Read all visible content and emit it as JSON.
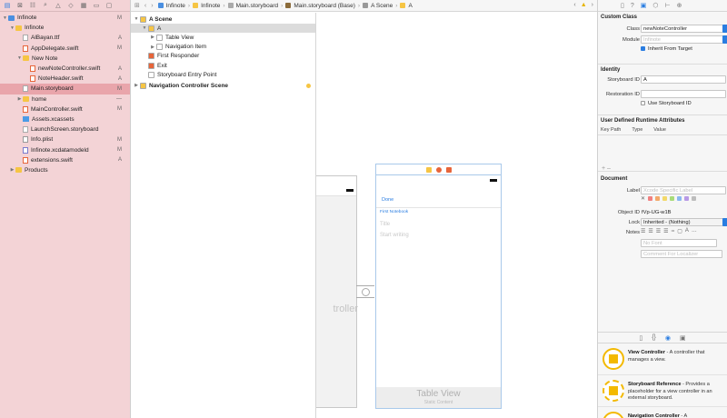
{
  "navigator": {
    "items": [
      {
        "name": "Infinote",
        "icon": "project",
        "indent": 0,
        "disc": "▼",
        "badge": "M"
      },
      {
        "name": "Infinote",
        "icon": "folder",
        "indent": 1,
        "disc": "▼",
        "badge": ""
      },
      {
        "name": "AlBayan.ttf",
        "icon": "file",
        "indent": 2,
        "disc": "",
        "badge": "A"
      },
      {
        "name": "AppDelegate.swift",
        "icon": "swift",
        "indent": 2,
        "disc": "",
        "badge": "M"
      },
      {
        "name": "New Note",
        "icon": "folder",
        "indent": 2,
        "disc": "▼",
        "badge": ""
      },
      {
        "name": "newNoteController.swift",
        "icon": "swift",
        "indent": 3,
        "disc": "",
        "badge": "A"
      },
      {
        "name": "NoteHeader.swift",
        "icon": "swift",
        "indent": 3,
        "disc": "",
        "badge": "A"
      },
      {
        "name": "Main.storyboard",
        "icon": "sb",
        "indent": 2,
        "disc": "",
        "badge": "M",
        "selected": true
      },
      {
        "name": "home",
        "icon": "folder",
        "indent": 2,
        "disc": "▶",
        "badge": "—"
      },
      {
        "name": "MainController.swift",
        "icon": "swift",
        "indent": 2,
        "disc": "",
        "badge": "M"
      },
      {
        "name": "Assets.xcassets",
        "icon": "assets",
        "indent": 2,
        "disc": "",
        "badge": ""
      },
      {
        "name": "LaunchScreen.storyboard",
        "icon": "sb",
        "indent": 2,
        "disc": "",
        "badge": ""
      },
      {
        "name": "Info.plist",
        "icon": "plist",
        "indent": 2,
        "disc": "",
        "badge": "M"
      },
      {
        "name": "Infinote.xcdatamodeld",
        "icon": "model",
        "indent": 2,
        "disc": "",
        "badge": "M"
      },
      {
        "name": "extensions.swift",
        "icon": "swift",
        "indent": 2,
        "disc": "",
        "badge": "A"
      },
      {
        "name": "Products",
        "icon": "folder",
        "indent": 1,
        "disc": "▶",
        "badge": ""
      }
    ]
  },
  "jumpbar": {
    "crumbs": [
      "Infinote",
      "Infinote",
      "Main.storyboard",
      "Main.storyboard (Base)",
      "A Scene",
      "A"
    ]
  },
  "outline": {
    "items": [
      {
        "label": "A Scene",
        "indent": 0,
        "disc": "▼",
        "bold": true,
        "color": "#f6c544"
      },
      {
        "label": "A",
        "indent": 1,
        "disc": "▼",
        "bold": false,
        "color": "#f6c544",
        "selected": true
      },
      {
        "label": "Table View",
        "indent": 2,
        "disc": "▶",
        "bold": false,
        "color": "#ffffff"
      },
      {
        "label": "Navigation Item",
        "indent": 2,
        "disc": "▶",
        "bold": false,
        "color": "#ffffff"
      },
      {
        "label": "First Responder",
        "indent": 1,
        "disc": "",
        "bold": false,
        "color": "#e7653a"
      },
      {
        "label": "Exit",
        "indent": 1,
        "disc": "",
        "bold": false,
        "color": "#e7653a"
      },
      {
        "label": "Storyboard Entry Point",
        "indent": 1,
        "disc": "",
        "bold": false,
        "color": "#ffffff"
      },
      {
        "label": "Navigation Controller Scene",
        "indent": 0,
        "disc": "▶",
        "bold": true,
        "color": "#f6c544",
        "dot": true
      }
    ]
  },
  "canvas": {
    "left_ghost": "troller",
    "done": "Done",
    "first_notebook": "First Notebook",
    "title_placeholder": "Title",
    "start_placeholder": "Start writing",
    "table_view_title": "Table View",
    "table_view_sub": "Static Content"
  },
  "inspector": {
    "custom_class": {
      "title": "Custom Class",
      "class_label": "Class",
      "class_value": "newNoteController",
      "module_label": "Module",
      "module_placeholder": "Infinote",
      "inherit_label": "Inherit From Target"
    },
    "identity": {
      "title": "Identity",
      "storyboard_id_label": "Storyboard ID",
      "storyboard_id_value": "A",
      "restoration_id_label": "Restoration ID",
      "restoration_id_value": "",
      "use_sb_label": "Use Storyboard ID"
    },
    "runtime": {
      "title": "User Defined Runtime Attributes",
      "col_key": "Key Path",
      "col_type": "Type",
      "col_value": "Value",
      "plus": "+  –"
    },
    "document": {
      "title": "Document",
      "label_label": "Label",
      "label_placeholder": "Xcode Specific Label",
      "object_id_label": "Object ID",
      "object_id_value": "fVp-UG-w1B",
      "lock_label": "Lock",
      "lock_value": "Inherited - (Nothing)",
      "notes_label": "Notes",
      "no_font": "No Font",
      "comment_placeholder": "Comment For Localizer"
    },
    "swatch_colors": [
      "#f08080",
      "#f3a96a",
      "#f3d96a",
      "#a8dc7a",
      "#8ab8f0",
      "#b89ae6",
      "#bdbdbd"
    ]
  },
  "library": {
    "items": [
      {
        "title": "View Controller",
        "desc": " - A controller that manages a view.",
        "dashed": false
      },
      {
        "title": "Storyboard Reference",
        "desc": " - Provides a placeholder for a view controller in an external storyboard.",
        "dashed": true
      },
      {
        "title": "Navigation Controller",
        "desc": " - A",
        "dashed": false
      }
    ]
  }
}
